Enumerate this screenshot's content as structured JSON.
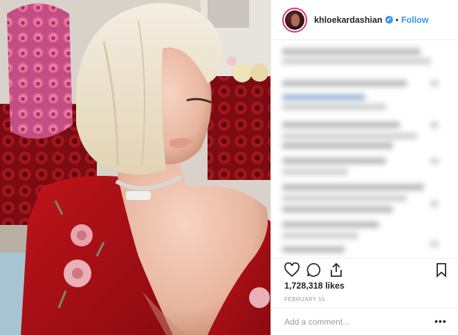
{
  "header": {
    "username": "khloekardashian",
    "verified_mark": "✔",
    "separator": "•",
    "follow_label": "Follow"
  },
  "actions": {
    "like_icon": "heart-outline-icon",
    "comment_icon": "speech-bubble-icon",
    "share_icon": "share-arrow-icon",
    "save_icon": "bookmark-outline-icon"
  },
  "post": {
    "likes": "1,728,318 likes",
    "date": "February 15"
  },
  "comment_box": {
    "placeholder": "Add a comment...",
    "more_label": "•••"
  },
  "colors": {
    "link": "#3897f0",
    "text": "#262626",
    "muted": "#999999"
  }
}
